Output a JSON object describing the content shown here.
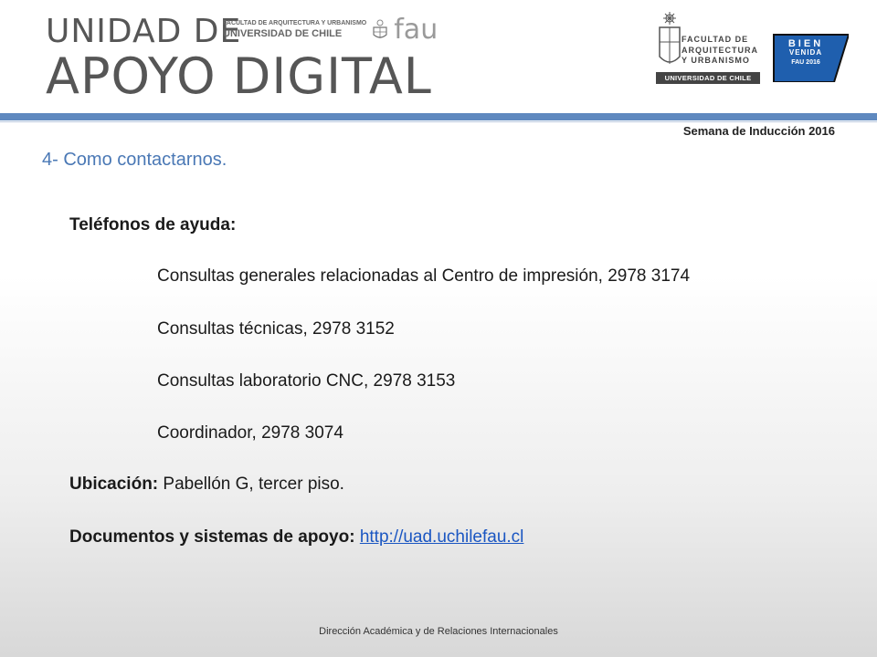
{
  "header": {
    "title_line1": "UNIDAD DE",
    "title_line2": "APOYO DIGITAL",
    "fau_small_line1": "FACULTAD DE ARQUITECTURA Y URBANISMO",
    "fau_small_line2": "UNIVERSIDAD DE CHILE",
    "fau_logo": "fau",
    "uchile_text_1": "FACULTAD DE",
    "uchile_text_2": "ARQUITECTURA",
    "uchile_text_3": "Y URBANISMO",
    "uchile_bar": "UNIVERSIDAD DE CHILE",
    "badge_line1": "BIEN",
    "badge_line2": "VENIDA",
    "badge_line3": "FAU 2016"
  },
  "subtitle": "Semana de Inducción 2016",
  "section_title": "4- Como contactarnos.",
  "phones": {
    "heading": "Teléfonos de ayuda:",
    "items": [
      "Consultas generales relacionadas  al Centro de impresión, 2978 3174",
      "Consultas técnicas, 2978 3152",
      "Consultas laboratorio CNC, 2978 3153",
      "Coordinador, 2978 3074"
    ]
  },
  "location": {
    "label": "Ubicación:",
    "value": " Pabellón G, tercer piso."
  },
  "docs": {
    "label": "Documentos y sistemas de apoyo:",
    "link": "http://uad.uchilefau.cl"
  },
  "footer": "Dirección Académica y de Relaciones Internacionales",
  "colors": {
    "accent_blue": "#5f89bf",
    "section_blue": "#4a78b5",
    "badge_blue": "#1f5fae",
    "link_blue": "#1a56c2"
  }
}
